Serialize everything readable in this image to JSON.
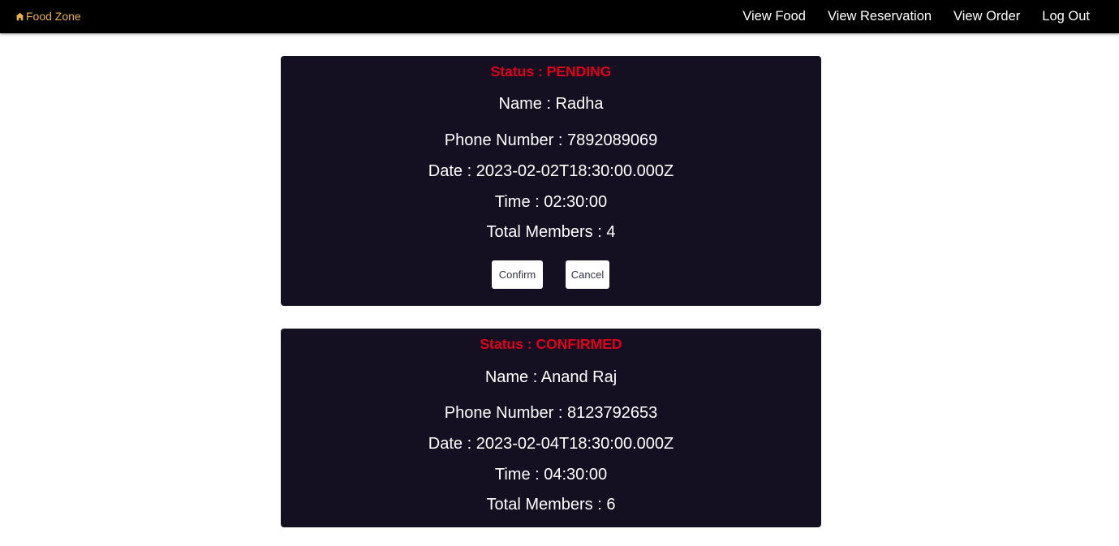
{
  "brand": {
    "label": "Food Zone",
    "icon": "home-icon",
    "color": "#e8b04a"
  },
  "nav": {
    "items": [
      {
        "label": "View Food"
      },
      {
        "label": "View Reservation"
      },
      {
        "label": "View Order"
      },
      {
        "label": "Log Out"
      }
    ]
  },
  "colors": {
    "card_bg": "#141022",
    "status": "#e0001b",
    "navbar_bg": "#000000"
  },
  "reservations": [
    {
      "status": "Status : PENDING",
      "name": "Name : Radha",
      "phone": "Phone Number : 7892089069",
      "date": "Date : 2023-02-02T18:30:00.000Z",
      "time": "Time : 02:30:00",
      "members": "Total Members : 4",
      "confirm_label": "Confirm",
      "cancel_label": "Cancel"
    },
    {
      "status": "Status : CONFIRMED",
      "name": "Name : Anand Raj",
      "phone": "Phone Number : 8123792653",
      "date": "Date : 2023-02-04T18:30:00.000Z",
      "time": "Time : 04:30:00",
      "members": "Total Members : 6"
    }
  ]
}
